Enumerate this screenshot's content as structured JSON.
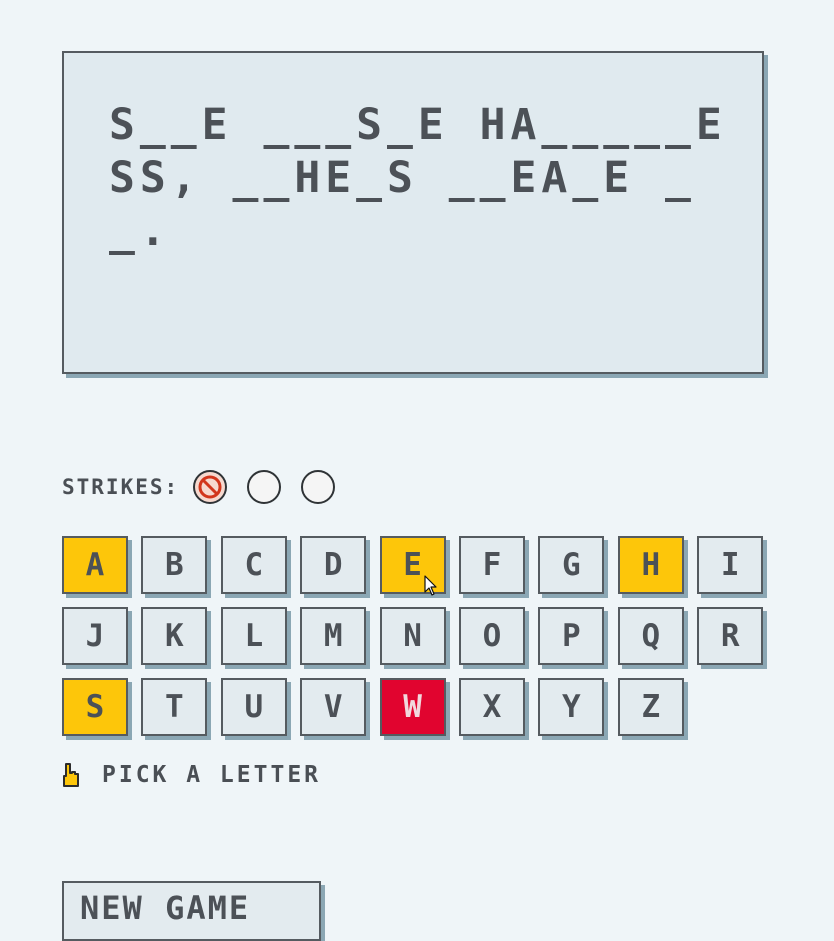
{
  "puzzle": {
    "text": "S__E ___S_E HA_____ESS, __HE_S __EA_E __."
  },
  "strikes": {
    "label": "STRIKES:",
    "total": 3,
    "used": 1
  },
  "keyboard": {
    "keys": [
      {
        "letter": "A",
        "state": "correct"
      },
      {
        "letter": "B",
        "state": "unused"
      },
      {
        "letter": "C",
        "state": "unused"
      },
      {
        "letter": "D",
        "state": "unused"
      },
      {
        "letter": "E",
        "state": "correct"
      },
      {
        "letter": "F",
        "state": "unused"
      },
      {
        "letter": "G",
        "state": "unused"
      },
      {
        "letter": "H",
        "state": "correct"
      },
      {
        "letter": "I",
        "state": "unused"
      },
      {
        "letter": "J",
        "state": "unused"
      },
      {
        "letter": "K",
        "state": "unused"
      },
      {
        "letter": "L",
        "state": "unused"
      },
      {
        "letter": "M",
        "state": "unused"
      },
      {
        "letter": "N",
        "state": "unused"
      },
      {
        "letter": "O",
        "state": "unused"
      },
      {
        "letter": "P",
        "state": "unused"
      },
      {
        "letter": "Q",
        "state": "unused"
      },
      {
        "letter": "R",
        "state": "unused"
      },
      {
        "letter": "S",
        "state": "correct"
      },
      {
        "letter": "T",
        "state": "unused"
      },
      {
        "letter": "U",
        "state": "unused"
      },
      {
        "letter": "V",
        "state": "unused"
      },
      {
        "letter": "W",
        "state": "wrong"
      },
      {
        "letter": "X",
        "state": "unused"
      },
      {
        "letter": "Y",
        "state": "unused"
      },
      {
        "letter": "Z",
        "state": "unused"
      }
    ]
  },
  "hint": {
    "icon": "pointing-hand-icon",
    "text": "PICK A LETTER"
  },
  "new_game": {
    "label": "NEW GAME"
  },
  "colors": {
    "background": "#eff5f8",
    "tile": "#e3ebef",
    "correct": "#fdc60a",
    "wrong": "#e1042f",
    "shadow": "#8ba7b4",
    "text": "#4c5157"
  }
}
